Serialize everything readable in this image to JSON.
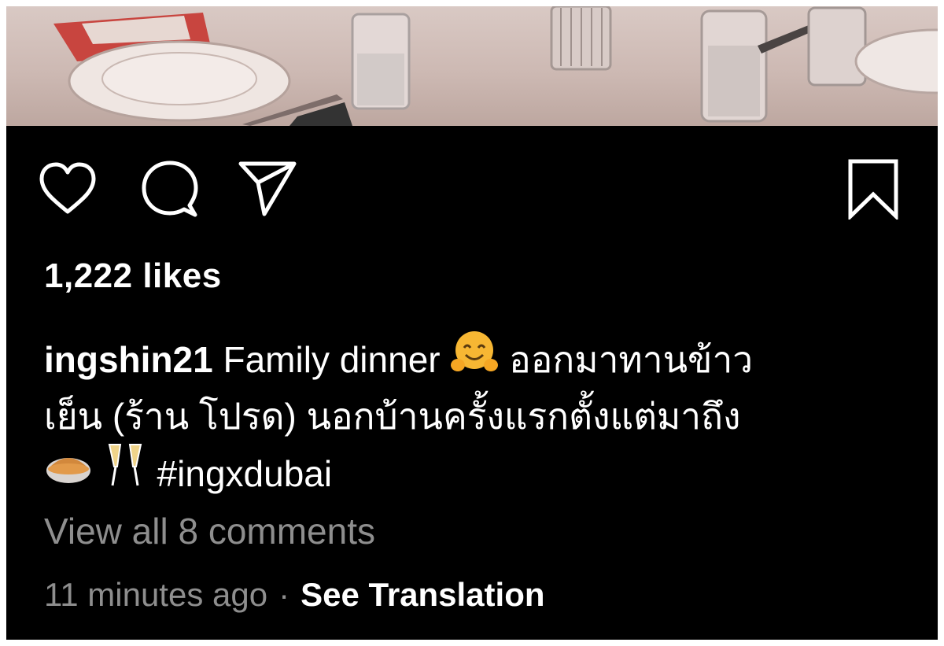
{
  "post": {
    "likes_text": "1,222 likes",
    "username": "ingshin21",
    "caption_line1": " Family dinner ",
    "caption_line1_thai": " ออกมาทานข้าว",
    "caption_line2": "เย็น (ร้าน โปรด) นอกบ้านครั้งแรกตั้งแต่มาถึง",
    "hashtag": " #ingxdubai",
    "view_comments": "View all 8 comments",
    "timestamp": "11 minutes ago",
    "separator": "·",
    "see_translation": "See Translation"
  },
  "icons": {
    "like": "heart-icon",
    "comment": "comment-icon",
    "share": "paper-plane-icon",
    "save": "bookmark-icon",
    "emoji1": "hugging-face-emoji",
    "emoji2": "pie-emoji",
    "emoji3": "clinking-glasses-emoji"
  },
  "colors": {
    "background": "#000000",
    "text": "#ffffff",
    "muted": "#8e8e8e"
  }
}
